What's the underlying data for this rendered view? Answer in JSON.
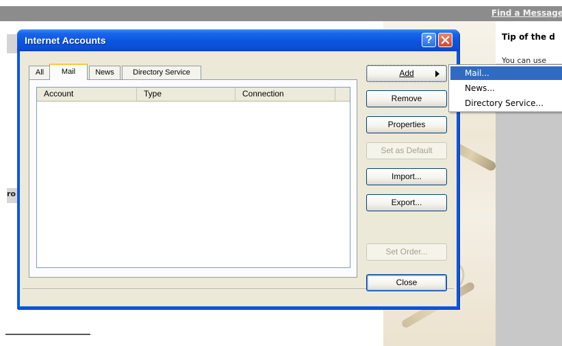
{
  "background": {
    "find_link": "Find a Message",
    "tip_title": "Tip of the d",
    "tip_text": "You can use",
    "left_fragment": "ro"
  },
  "dialog": {
    "title": "Internet Accounts",
    "help_label": "?",
    "tabs": [
      {
        "label": "All"
      },
      {
        "label": "Mail"
      },
      {
        "label": "News"
      },
      {
        "label": "Directory Service"
      }
    ],
    "columns": [
      "Account",
      "Type",
      "Connection"
    ],
    "buttons": {
      "add": "Add",
      "remove": "Remove",
      "properties": "Properties",
      "set_default": "Set as Default",
      "import": "Import...",
      "export": "Export...",
      "set_order": "Set Order...",
      "close": "Close"
    }
  },
  "add_menu": {
    "items": [
      {
        "label": "Mail..."
      },
      {
        "label": "News..."
      },
      {
        "label": "Directory Service..."
      }
    ]
  },
  "colors": {
    "title_blue": "#0a55df",
    "menu_highlight": "#316ac5",
    "dialog_face": "#ece9d8",
    "close_red": "#d3472b"
  }
}
